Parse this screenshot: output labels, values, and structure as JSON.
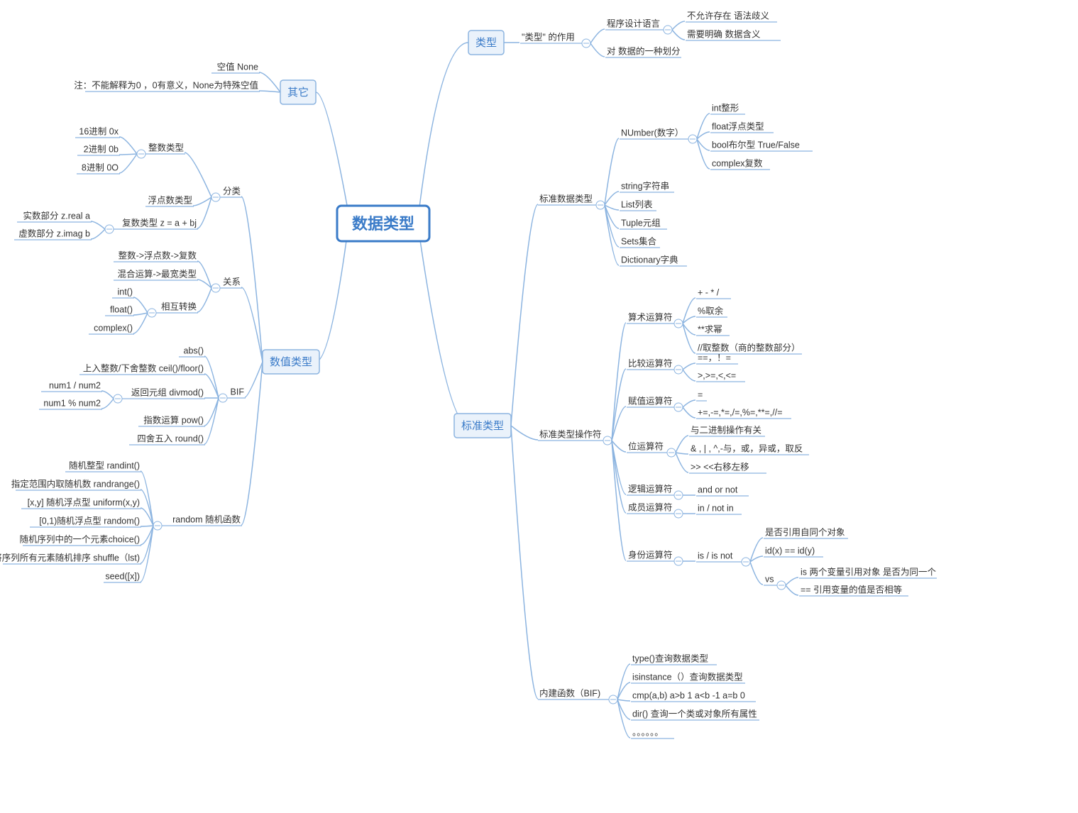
{
  "root": "数据类型",
  "main": {
    "other": "其它",
    "numeric": "数值类型",
    "type": "类型",
    "stdtype": "标准类型"
  },
  "left": {
    "other": {
      "none": "空值 None",
      "note": "注：不能解释为0 ，0有意义，None为特殊空值"
    },
    "numeric": {
      "cls": {
        "label": "分类",
        "int": {
          "label": "整数类型",
          "hex": "16进制  0x",
          "bin": "2进制  0b",
          "oct": "8进制 0O"
        },
        "float": "浮点数类型",
        "complex": {
          "label": "复数类型 z = a + bj",
          "real": "实数部分 z.real a",
          "imag": "虚数部分 z.imag b"
        }
      },
      "rel": {
        "label": "关系",
        "a": "整数->浮点数->复数",
        "b": "混合运算->最宽类型",
        "conv": {
          "label": "相互转换",
          "int": "int()",
          "float": "float()",
          "complex": "complex()"
        }
      },
      "bif": {
        "label": "BIF",
        "abs": "abs()",
        "ceil": "上入整数/下舍整数 ceil()/floor()",
        "divmod": {
          "label": "返回元组 divmod()",
          "a": "num1 / num2",
          "b": "num1 % num2"
        },
        "pow": "指数运算 pow()",
        "round": "四舍五入  round()"
      },
      "rand": {
        "label": "random  随机函数",
        "randint": "随机整型 randint()",
        "randrange": "指定范围内取随机数 randrange()",
        "uniform": "[x,y] 随机浮点型 uniform(x,y)",
        "random": "[0,1)随机浮点型 random()",
        "choice": "随机序列中的一个元素choice()",
        "shuffle": "将序列所有元素随机排序 shuffle（lst)",
        "seed": "seed([x])"
      }
    }
  },
  "right": {
    "type": {
      "role": {
        "label": "\"类型\" 的作用",
        "lang": {
          "label": "程序设计语言",
          "a": "不允许存在  语法歧义",
          "b": "需要明确    数据含义"
        },
        "div": "对 数据的一种划分"
      }
    },
    "stdtype": {
      "stddata": {
        "label": "标准数据类型",
        "number": {
          "label": "NUmber(数字）",
          "int": "int整形",
          "float": "float浮点类型",
          "bool": "bool布尔型  True/False",
          "complex": "complex复数"
        },
        "string": "string字符串",
        "list": "List列表",
        "tuple": "Tuple元组",
        "sets": "Sets集合",
        "dict": "Dictionary字典"
      },
      "op": {
        "label": "标准类型操作符",
        "arith": {
          "label": "算术运算符",
          "a": "+ - * /",
          "b": "%取余",
          "c": "**求幂",
          "d": "//取整数（商的整数部分）"
        },
        "cmp": {
          "label": "比较运算符",
          "a": "==，！=",
          "b": ">,>=,<,<="
        },
        "assign": {
          "label": "赋值运算符",
          "a": "=",
          "b": "+=,-=,*=,/=,%=,**=,//="
        },
        "bit": {
          "label": "位运算符",
          "a": "与二进制操作有关",
          "b": "& , | , ^,-与，或，异或，取反",
          "c": ">> <<右移左移"
        },
        "logic": {
          "label": "逻辑运算符",
          "v": "and  or not"
        },
        "member": {
          "label": "成员运算符",
          "v": "in / not in"
        },
        "id": {
          "label": "身份运算符",
          "v": "is / is not",
          "a": "是否引用自同个对象",
          "b": "id(x) == id(y)",
          "vs": {
            "label": "vs",
            "a": "is 两个变量引用对象 是否为同一个",
            "b": "== 引用变量的值是否相等"
          }
        }
      },
      "bif": {
        "label": "内建函数（BIF)",
        "type": "type()查询数据类型",
        "isinstance": "isinstance（）查询数据类型",
        "cmp": "cmp(a,b)  a>b 1 a<b -1 a=b 0",
        "dir": "dir() 查询一个类或对象所有属性",
        "dots": "。。。。。。"
      }
    }
  }
}
